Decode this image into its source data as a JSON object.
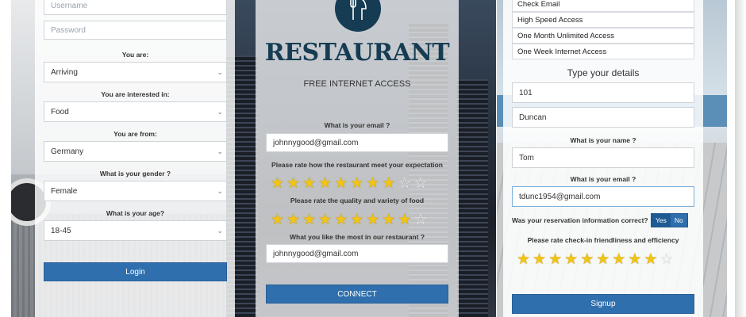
{
  "login_form": {
    "username_placeholder": "Username",
    "password_placeholder": "Password",
    "you_are_label": "You are:",
    "you_are_value": "Arriving",
    "interested_label": "You are interested in:",
    "interested_value": "Food",
    "from_label": "You are from:",
    "from_value": "Germany",
    "gender_label": "What is your gender ?",
    "gender_value": "Female",
    "age_label": "What is your age?",
    "age_value": "18-45",
    "login_button": "Login"
  },
  "restaurant_form": {
    "brand": "RESTAURANT",
    "subtitle": "FREE INTERNET ACCESS",
    "email_label": "What is your email ?",
    "email_value": "johnnygood@gmail.com",
    "rating1_label": "Please rate how the restaurant meet your expectation",
    "rating1_value": 8,
    "rating2_label": "Please rate the quality and variety of food",
    "rating2_value": 9,
    "like_label": "What you like the most in our restaurant ?",
    "like_value": "johnnygood@gmail.com",
    "connect_button": "CONNECT",
    "max_stars": 10
  },
  "signup_form": {
    "plans": [
      "Check Email",
      "High Speed Access",
      "One Month Unlimited Access",
      "One Week Internet Access"
    ],
    "details_heading": "Type your details",
    "room_value": "101",
    "lastname_value": "Duncan",
    "name_label": "What is your name ?",
    "name_value": "Tom",
    "email_label": "What is your email ?",
    "email_value": "tdunc1954@gmail.com",
    "reservation_label": "Was your reservation information correct?",
    "yes_label": "Yes",
    "no_label": "No",
    "rating_label": "Please rate check-in friendliness and efficiency",
    "rating_value": 9,
    "max_stars": 10,
    "signup_button": "Signup"
  },
  "colors": {
    "primary_button": "#2f6fad",
    "brand_navy": "#153c53",
    "star_on": "#f2c413"
  }
}
